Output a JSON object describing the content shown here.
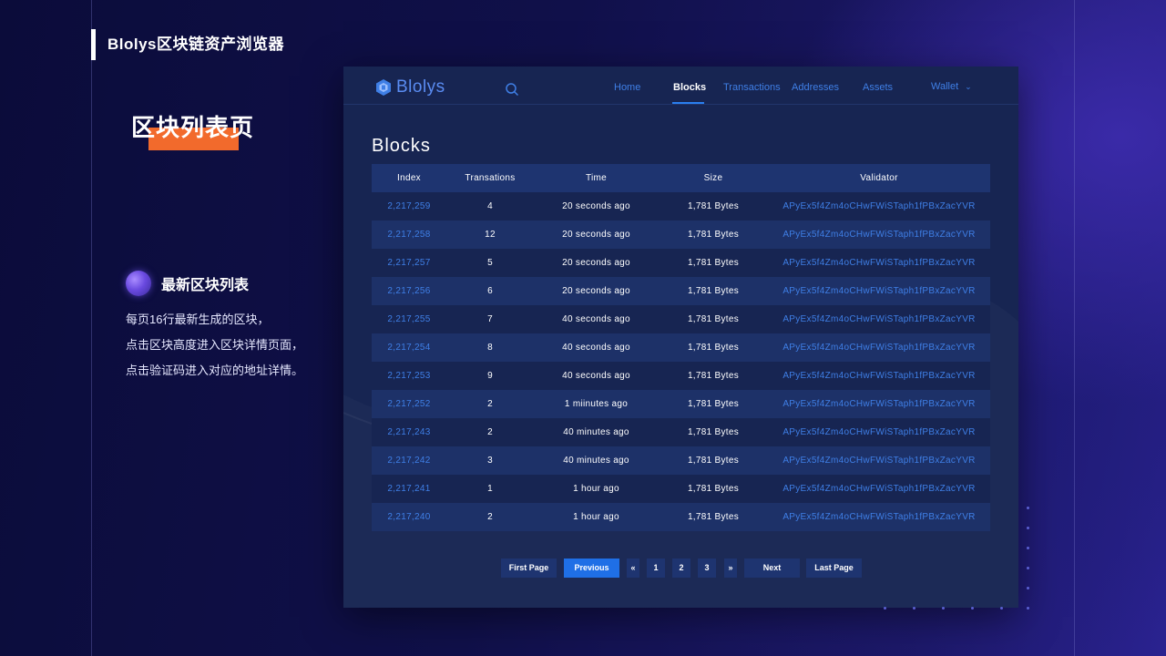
{
  "deck": {
    "title": "Blolys区块链资产浏览器",
    "page_heading": "区块列表页",
    "feature_title": "最新区块列表",
    "feature_lines": [
      "每页16行最新生成的区块，",
      "点击区块高度进入区块详情页面，",
      "点击验证码进入对应的地址详情。"
    ]
  },
  "app": {
    "brand": "Blolys",
    "nav": [
      {
        "label": "Home",
        "active": false
      },
      {
        "label": "Blocks",
        "active": true
      },
      {
        "label": "Transactions",
        "active": false
      },
      {
        "label": "Addresses",
        "active": false
      },
      {
        "label": "Assets",
        "active": false
      },
      {
        "label": "Wallet",
        "active": false
      }
    ],
    "section_title": "Blocks",
    "columns": [
      "Index",
      "Transations",
      "Time",
      "Size",
      "Validator"
    ],
    "rows": [
      {
        "index": "2,217,259",
        "tx": "4",
        "time": "20 seconds ago",
        "size": "1,781 Bytes",
        "validator": "APyEx5f4Zm4oCHwFWiSTaph1fPBxZacYVR"
      },
      {
        "index": "2,217,258",
        "tx": "12",
        "time": "20 seconds ago",
        "size": "1,781 Bytes",
        "validator": "APyEx5f4Zm4oCHwFWiSTaph1fPBxZacYVR"
      },
      {
        "index": "2,217,257",
        "tx": "5",
        "time": "20 seconds ago",
        "size": "1,781 Bytes",
        "validator": "APyEx5f4Zm4oCHwFWiSTaph1fPBxZacYVR"
      },
      {
        "index": "2,217,256",
        "tx": "6",
        "time": "20 seconds ago",
        "size": "1,781 Bytes",
        "validator": "APyEx5f4Zm4oCHwFWiSTaph1fPBxZacYVR"
      },
      {
        "index": "2,217,255",
        "tx": "7",
        "time": "40 seconds ago",
        "size": "1,781 Bytes",
        "validator": "APyEx5f4Zm4oCHwFWiSTaph1fPBxZacYVR"
      },
      {
        "index": "2,217,254",
        "tx": "8",
        "time": "40 seconds ago",
        "size": "1,781 Bytes",
        "validator": "APyEx5f4Zm4oCHwFWiSTaph1fPBxZacYVR"
      },
      {
        "index": "2,217,253",
        "tx": "9",
        "time": "40 seconds ago",
        "size": "1,781 Bytes",
        "validator": "APyEx5f4Zm4oCHwFWiSTaph1fPBxZacYVR"
      },
      {
        "index": "2,217,252",
        "tx": "2",
        "time": "1 miinutes ago",
        "size": "1,781 Bytes",
        "validator": "APyEx5f4Zm4oCHwFWiSTaph1fPBxZacYVR"
      },
      {
        "index": "2,217,243",
        "tx": "2",
        "time": "40 minutes ago",
        "size": "1,781 Bytes",
        "validator": "APyEx5f4Zm4oCHwFWiSTaph1fPBxZacYVR"
      },
      {
        "index": "2,217,242",
        "tx": "3",
        "time": "40 minutes ago",
        "size": "1,781 Bytes",
        "validator": "APyEx5f4Zm4oCHwFWiSTaph1fPBxZacYVR"
      },
      {
        "index": "2,217,241",
        "tx": "1",
        "time": "1 hour ago",
        "size": "1,781 Bytes",
        "validator": "APyEx5f4Zm4oCHwFWiSTaph1fPBxZacYVR"
      },
      {
        "index": "2,217,240",
        "tx": "2",
        "time": "1 hour ago",
        "size": "1,781 Bytes",
        "validator": "APyEx5f4Zm4oCHwFWiSTaph1fPBxZacYVR"
      }
    ],
    "pager": {
      "first": "First Page",
      "previous": "Previous",
      "prev_arrow": "«",
      "pages": [
        "1",
        "2",
        "3"
      ],
      "next_arrow": "»",
      "next": "Next",
      "last": "Last Page"
    },
    "colors": {
      "accent": "#f26a2c",
      "link": "#3f7fe6",
      "panel": "#172552",
      "button_primary": "#1f6fe6"
    }
  },
  "icons": [
    "logo-mark-icon",
    "search-icon",
    "chevron-down-icon"
  ]
}
